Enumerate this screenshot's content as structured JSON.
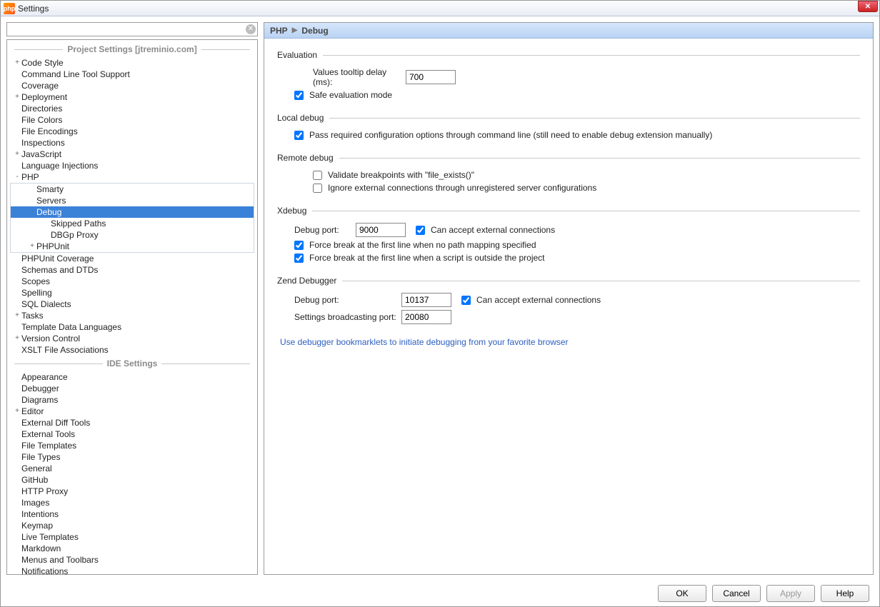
{
  "window": {
    "title": "Settings",
    "app_icon_text": "php"
  },
  "search": {
    "placeholder": ""
  },
  "section_headers": {
    "project": "Project Settings [jtreminio.com]",
    "ide": "IDE Settings"
  },
  "project_tree": [
    {
      "label": "Code Style",
      "exp": "+"
    },
    {
      "label": "Command Line Tool Support"
    },
    {
      "label": "Coverage"
    },
    {
      "label": "Deployment",
      "exp": "+"
    },
    {
      "label": "Directories"
    },
    {
      "label": "File Colors"
    },
    {
      "label": "File Encodings"
    },
    {
      "label": "Inspections"
    },
    {
      "label": "JavaScript",
      "exp": "+"
    },
    {
      "label": "Language Injections"
    }
  ],
  "php_node": {
    "label": "PHP",
    "exp": "-"
  },
  "php_children": [
    {
      "label": "Smarty",
      "level": 2
    },
    {
      "label": "Servers",
      "level": 2
    },
    {
      "label": "Debug",
      "level": 2,
      "exp": "-",
      "selected": true
    },
    {
      "label": "Skipped Paths",
      "level": 3
    },
    {
      "label": "DBGp Proxy",
      "level": 3
    },
    {
      "label": "PHPUnit",
      "level": 2,
      "exp": "+"
    }
  ],
  "project_tree_after": [
    {
      "label": "PHPUnit Coverage"
    },
    {
      "label": "Schemas and DTDs"
    },
    {
      "label": "Scopes"
    },
    {
      "label": "Spelling"
    },
    {
      "label": "SQL Dialects"
    },
    {
      "label": "Tasks",
      "exp": "+"
    },
    {
      "label": "Template Data Languages"
    },
    {
      "label": "Version Control",
      "exp": "+"
    },
    {
      "label": "XSLT File Associations"
    }
  ],
  "ide_tree": [
    {
      "label": "Appearance"
    },
    {
      "label": "Debugger"
    },
    {
      "label": "Diagrams"
    },
    {
      "label": "Editor",
      "exp": "+"
    },
    {
      "label": "External Diff Tools"
    },
    {
      "label": "External Tools"
    },
    {
      "label": "File Templates"
    },
    {
      "label": "File Types"
    },
    {
      "label": "General"
    },
    {
      "label": "GitHub"
    },
    {
      "label": "HTTP Proxy"
    },
    {
      "label": "Images"
    },
    {
      "label": "Intentions"
    },
    {
      "label": "Keymap"
    },
    {
      "label": "Live Templates"
    },
    {
      "label": "Markdown"
    },
    {
      "label": "Menus and Toolbars"
    },
    {
      "label": "Notifications"
    }
  ],
  "breadcrumb": {
    "root": "PHP",
    "leaf": "Debug"
  },
  "evaluation": {
    "title": "Evaluation",
    "tooltip_label": "Values tooltip delay (ms):",
    "tooltip_value": "700",
    "safe_eval": "Safe evaluation mode"
  },
  "local_debug": {
    "title": "Local debug",
    "pass_config": "Pass required configuration options through command line (still need to enable debug extension manually)"
  },
  "remote_debug": {
    "title": "Remote debug",
    "validate": "Validate breakpoints with \"file_exists()\"",
    "ignore_ext": "Ignore external connections through unregistered server configurations"
  },
  "xdebug": {
    "title": "Xdebug",
    "port_label": "Debug port:",
    "port_value": "9000",
    "accept": "Can accept external connections",
    "force1": "Force break at the first line when no path mapping specified",
    "force2": "Force break at the first line when a script is outside the project"
  },
  "zend": {
    "title": "Zend Debugger",
    "port_label": "Debug port:",
    "port_value": "10137",
    "accept": "Can accept external connections",
    "broadcast_label": "Settings broadcasting port:",
    "broadcast_value": "20080"
  },
  "link_text": "Use debugger bookmarklets to initiate debugging from your favorite browser",
  "buttons": {
    "ok": "OK",
    "cancel": "Cancel",
    "apply": "Apply",
    "help": "Help"
  }
}
